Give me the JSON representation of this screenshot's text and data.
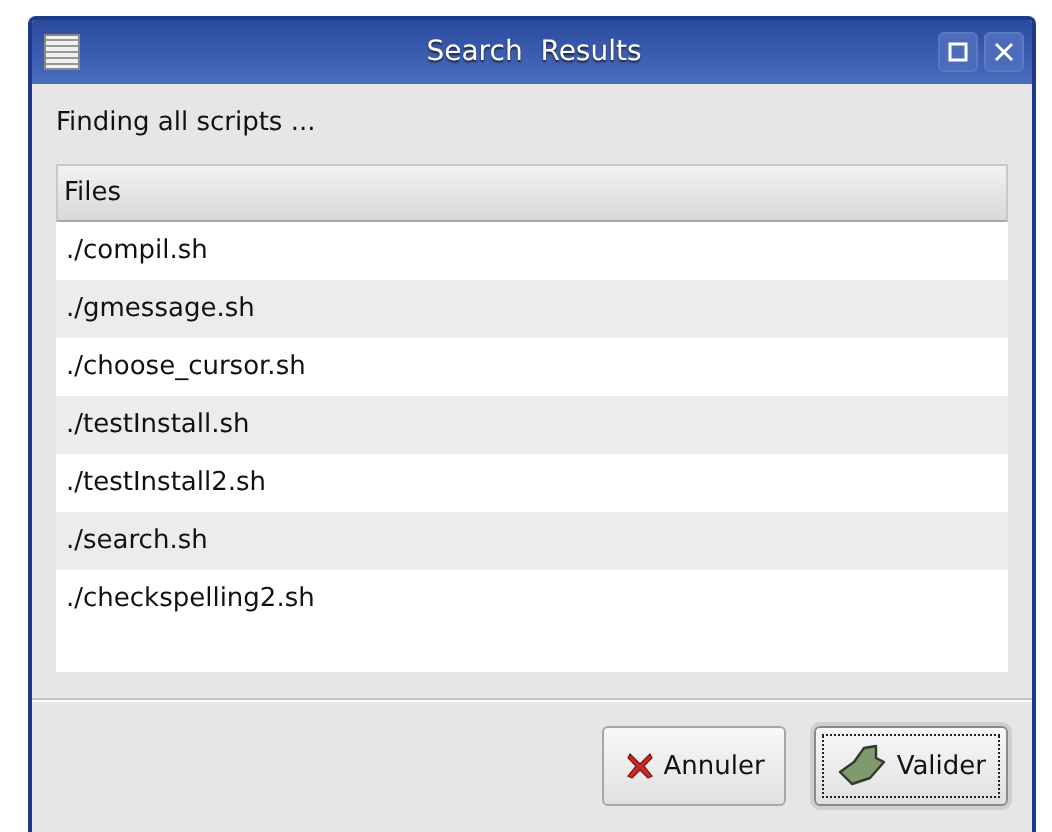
{
  "window": {
    "title": "Search  Results"
  },
  "status_text": "Finding all scripts ...",
  "table": {
    "columns": [
      "Files"
    ],
    "rows": [
      {
        "cells": [
          "./compil.sh"
        ],
        "selected": false
      },
      {
        "cells": [
          "./gmessage.sh"
        ],
        "selected": false
      },
      {
        "cells": [
          "./choose_cursor.sh"
        ],
        "selected": false
      },
      {
        "cells": [
          "./testInstall.sh"
        ],
        "selected": false
      },
      {
        "cells": [
          "./testInstall2.sh"
        ],
        "selected": false
      },
      {
        "cells": [
          "./search.sh"
        ],
        "selected": false
      },
      {
        "cells": [
          "./checkspelling2.sh"
        ],
        "selected": false
      }
    ]
  },
  "buttons": [
    {
      "label": "Annuler",
      "kind": "cancel",
      "focused": false
    },
    {
      "label": "Valider",
      "kind": "ok",
      "focused": true
    }
  ]
}
